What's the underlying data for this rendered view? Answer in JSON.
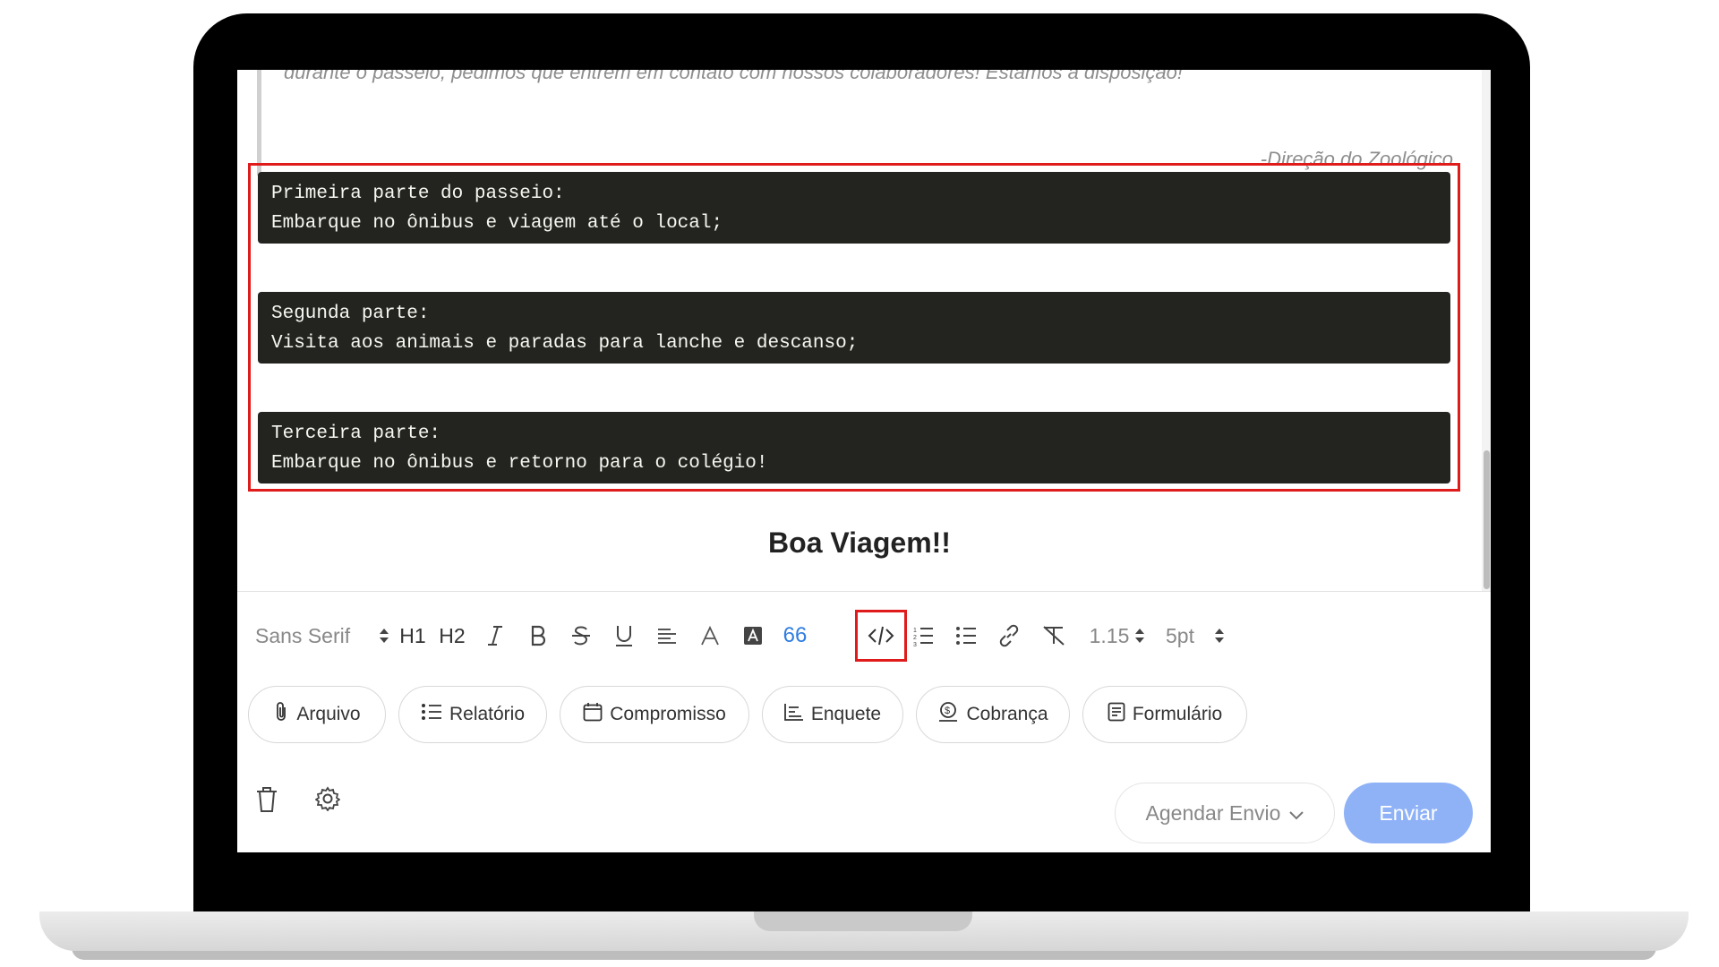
{
  "message": {
    "quote_text": "durante o passeio, pedimos que entrem em contato com nossos colaboradores! Estamos a disposição!",
    "quote_signature": "-Direção do Zoológico",
    "code_blocks": [
      {
        "line1": "Primeira parte do passeio:",
        "line2": "Embarque no ônibus e viagem até o local;"
      },
      {
        "line1": "Segunda parte:",
        "line2": "Visita aos animais e paradas para lanche e descanso;"
      },
      {
        "line1": "Terceira parte:",
        "line2": "Embarque no ônibus e retorno para o colégio!"
      }
    ],
    "closing": "Boa Viagem!!"
  },
  "toolbar": {
    "font_family": "Sans Serif",
    "h1": "H1",
    "h2": "H2",
    "line_height": "1.15",
    "font_size": "5pt",
    "quote_glyph": "66"
  },
  "actions": [
    {
      "label": "Arquivo",
      "icon": "paperclip-icon"
    },
    {
      "label": "Relatório",
      "icon": "list-icon"
    },
    {
      "label": "Compromisso",
      "icon": "calendar-icon"
    },
    {
      "label": "Enquete",
      "icon": "poll-icon"
    },
    {
      "label": "Cobrança",
      "icon": "money-icon"
    },
    {
      "label": "Formulário",
      "icon": "form-icon"
    }
  ],
  "footer": {
    "schedule_label": "Agendar Envio",
    "send_label": "Enviar"
  },
  "colors": {
    "send_button": "#8fb2f7",
    "highlight": "#e01b1b",
    "code_background": "#23241f"
  }
}
